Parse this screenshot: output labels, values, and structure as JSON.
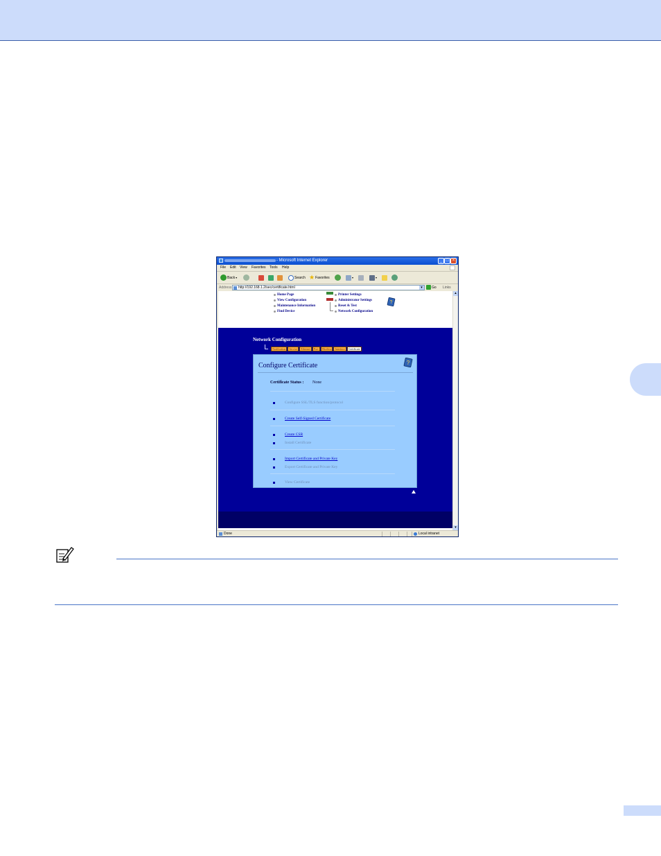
{
  "window": {
    "title": "- Microsoft Internet Explorer",
    "controls": {
      "minimize": "_",
      "maximize": "□",
      "close": "×"
    }
  },
  "menu": [
    "File",
    "Edit",
    "View",
    "Favorites",
    "Tools",
    "Help"
  ],
  "toolbar": {
    "back": "Back",
    "search": "Search",
    "favorites": "Favorites"
  },
  "address": {
    "label": "Address",
    "url": "http://192.168.1.2/sec/certificate.html",
    "go": "Go",
    "links": "Links"
  },
  "nav": {
    "left": [
      "Home Page",
      "View Configuration",
      "Maintenance Information",
      "Find Device"
    ],
    "right": [
      "Printer Settings",
      "Administrator Settings",
      "Reset & Test",
      "Network Configuration"
    ]
  },
  "network": {
    "title": "Network Configuration",
    "tabs": [
      "Notification",
      "Service",
      "Ethernet",
      "Port",
      "Wireless",
      "Interface",
      "Certificate"
    ],
    "active_tab": "Certificate"
  },
  "certificate": {
    "title": "Configure Certificate",
    "status_label": "Certificate Status :",
    "status_value": "None",
    "options": [
      {
        "label": "Configure SSL/TLS function/protocol",
        "enabled": false
      },
      {
        "label": "Create Self-Signed Certificate",
        "enabled": true
      },
      {
        "label": "Create CSR",
        "enabled": true
      },
      {
        "label": "Install Certificate",
        "enabled": false
      },
      {
        "label": "Import Certificate and Private Key",
        "enabled": true
      },
      {
        "label": "Export Certificate and Private Key",
        "enabled": false
      },
      {
        "label": "View Certificate",
        "enabled": false
      }
    ]
  },
  "statusbar": {
    "left": "Done",
    "zone": "Local intranet"
  },
  "colors": {
    "page_band": "#ccdcfb",
    "page_rule": "#4a74c7",
    "network_bg": "#000099",
    "panel_bg": "#99ccff",
    "tab_bg": "#ffb24a"
  }
}
